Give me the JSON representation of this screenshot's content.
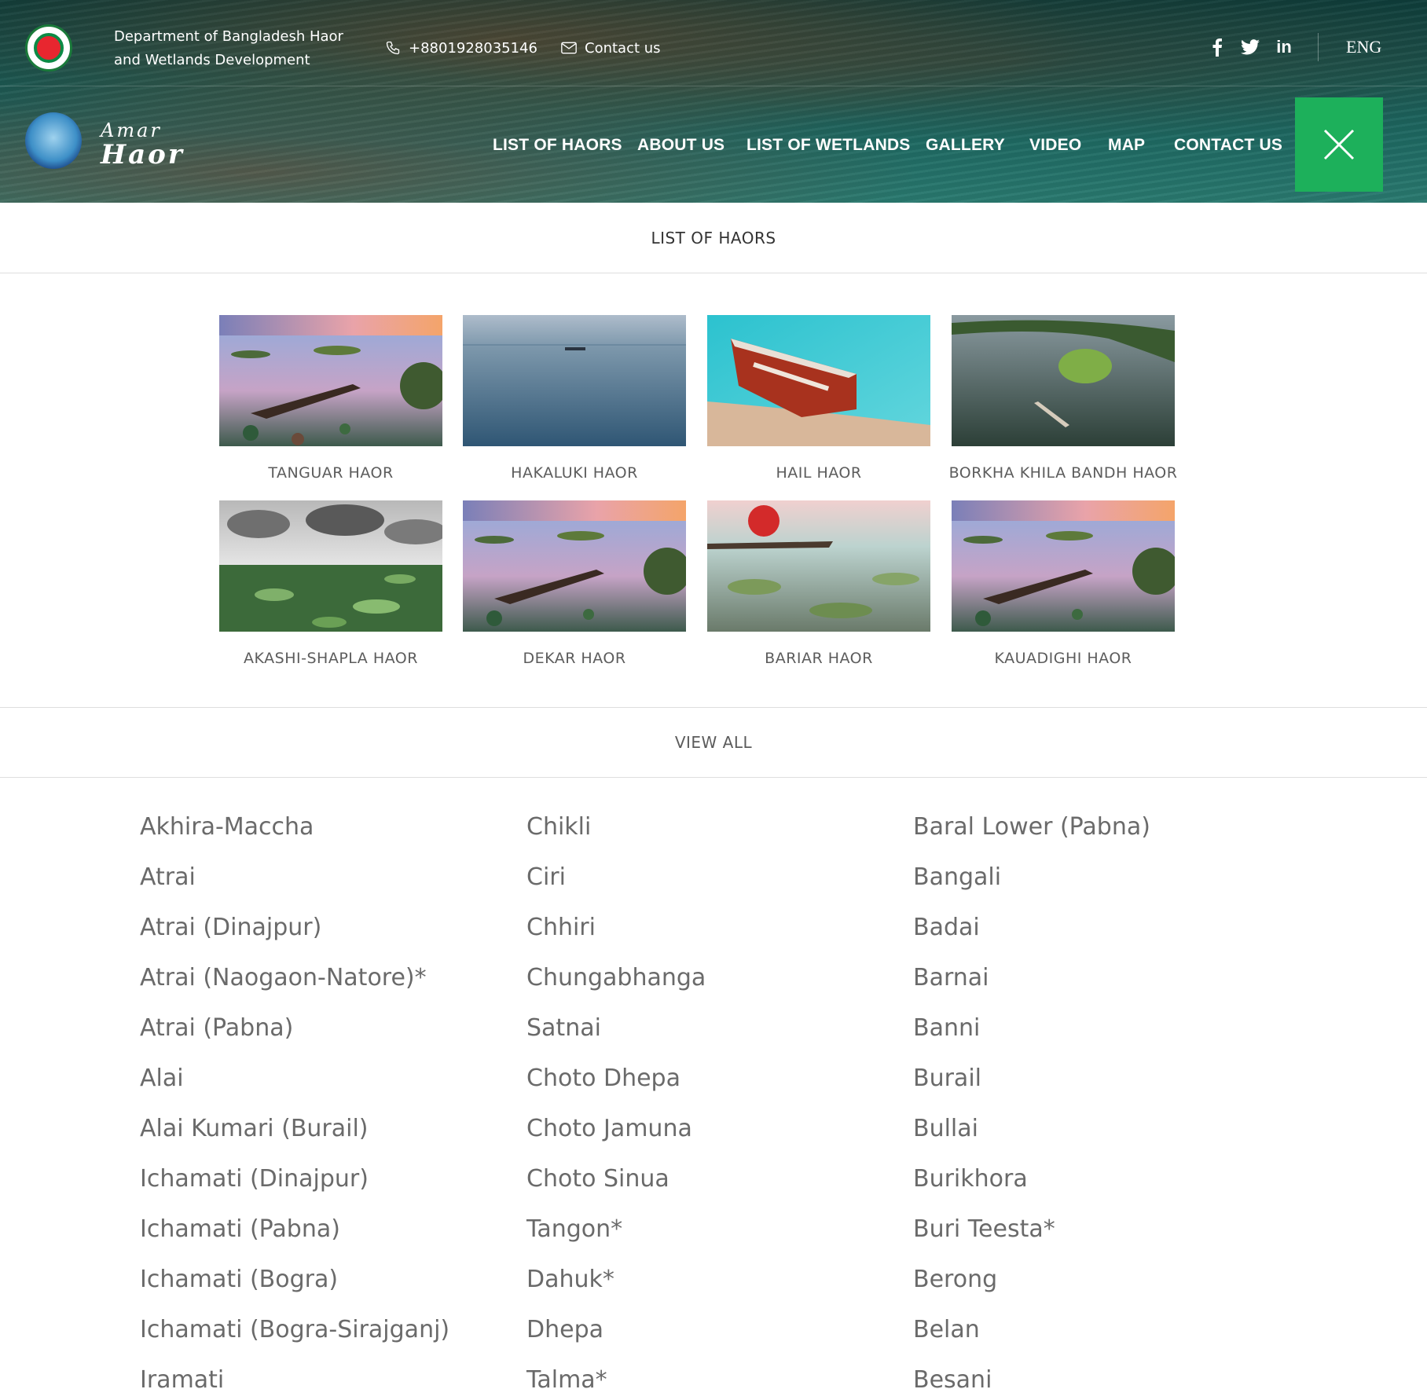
{
  "header": {
    "department_name": "Department of Bangladesh Haor and Wetlands Development",
    "phone": "+8801928035146",
    "contact_label": "Contact us",
    "social": [
      "facebook-icon",
      "twitter-icon",
      "linkedin-icon"
    ],
    "linkedin_text": "in",
    "language": "ENG",
    "brand_top": "Amar",
    "brand_bottom": "Haor"
  },
  "nav": {
    "items": [
      "LIST OF HAORS",
      "ABOUT US",
      "LIST OF WETLANDS",
      "GALLERY",
      "VIDEO",
      "MAP",
      "CONTACT US"
    ],
    "close_icon": "close-icon",
    "accent_color": "#1db05b"
  },
  "section": {
    "title": "LIST OF HAORS"
  },
  "cards": [
    {
      "name": "TANGUAR HAOR",
      "image": "sunset-boat-photo"
    },
    {
      "name": "HAKALUKI HAOR",
      "image": "open-water-photo"
    },
    {
      "name": "HAIL HAOR",
      "image": "red-boat-photo"
    },
    {
      "name": "BORKHA KHILA BANDH HAOR",
      "image": "island-aerial-photo"
    },
    {
      "name": "AKASHI-SHAPLA HAOR",
      "image": "lily-clouds-photo"
    },
    {
      "name": "DEKAR HAOR",
      "image": "sunset-boat-photo"
    },
    {
      "name": "BARIAR HAOR",
      "image": "umbrella-boat-photo"
    },
    {
      "name": "KAUADIGHI HAOR",
      "image": "sunset-boat-photo"
    }
  ],
  "view_all": "VIEW ALL",
  "haor_list": {
    "col1": [
      "Akhira-Maccha",
      "Atrai",
      "Atrai (Dinajpur)",
      "Atrai (Naogaon-Natore)*",
      "Atrai (Pabna)",
      "Alai",
      "Alai Kumari (Burail)",
      "Ichamati (Dinajpur)",
      "Ichamati (Pabna)",
      "Ichamati (Bogra)",
      "Ichamati (Bogra-Sirajganj)",
      "Iramati"
    ],
    "col2": [
      "Chikli",
      "Ciri",
      "Chhiri",
      "Chungabhanga",
      "Satnai",
      "Choto Dhepa",
      "Choto Jamuna",
      "Choto Sinua",
      "Tangon*",
      "Dahuk*",
      "Dhepa",
      "Talma*"
    ],
    "col3": [
      "Baral Lower (Pabna)",
      "Bangali",
      "Badai",
      "Barnai",
      "Banni",
      "Burail",
      "Bullai",
      "Burikhora",
      "Buri Teesta*",
      "Berong",
      "Belan",
      "Besani"
    ]
  }
}
